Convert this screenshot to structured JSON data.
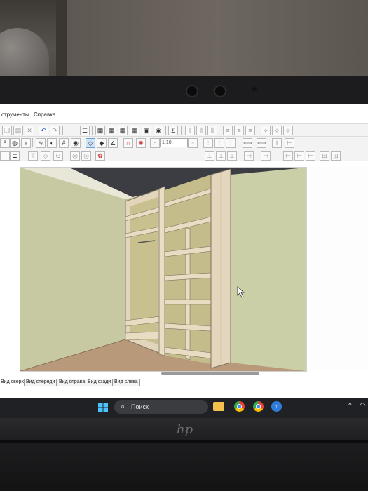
{
  "menu": {
    "items": [
      "струменты",
      "Справка"
    ]
  },
  "toolbar": {
    "zoom_value": "1:10",
    "row1_icons": [
      "copy-icon",
      "paste-icon",
      "delete-icon",
      "undo-icon",
      "redo-icon",
      "properties-icon",
      "panel-icon",
      "panel-icon",
      "panel-icon",
      "panel-icon",
      "panel-icon",
      "coin-icon",
      "sum-icon",
      "align-icon",
      "align-icon",
      "align-icon",
      "align-icon",
      "align-icon",
      "align-icon",
      "align-icon",
      "align-icon",
      "align-icon"
    ],
    "row2_icons": [
      "render-icon",
      "materials-icon",
      "light-icon",
      "layers-icon",
      "grid-icon",
      "eye-icon",
      "snap-icon",
      "snap-point-icon",
      "angle-icon",
      "magnet-icon",
      "target-icon",
      "zoom-icon"
    ],
    "row3_icons": [
      "section-icon",
      "edge-icon",
      "drill-icon",
      "hinge-icon",
      "handle-icon",
      "eye-icon",
      "eye-icon",
      "gear-icon"
    ]
  },
  "view_tabs": [
    "Вид сверху",
    "Вид спереди",
    "Вид справа",
    "Вид сзади",
    "Вид слева"
  ],
  "active_view_tab": 0,
  "taskbar": {
    "search_placeholder": "Поиск",
    "apps": [
      "windows-start-icon",
      "file-explorer-icon",
      "chrome-icon",
      "chrome-icon",
      "k3-app-icon"
    ]
  },
  "colors": {
    "wall": "#c7caa0",
    "floor": "#b89a7a",
    "ceiling": "#3c3d42",
    "cabinet": "#e3d6bd",
    "cabinet_edge": "#8b7f6c",
    "selection": "#cde3f7"
  }
}
